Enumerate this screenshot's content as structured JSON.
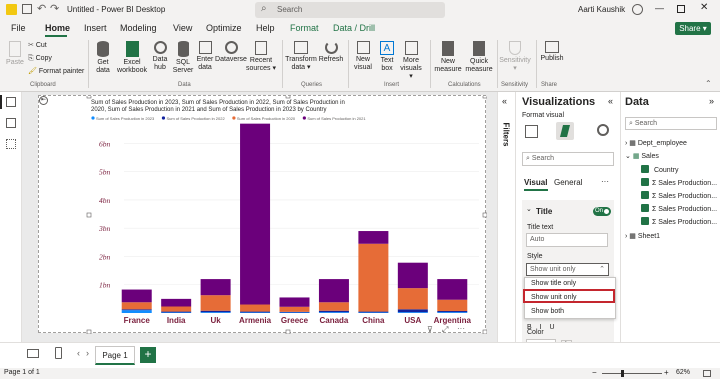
{
  "titlebar": {
    "title": "Untitled - Power BI Desktop",
    "search": "Search",
    "user": "Aarti Kaushik"
  },
  "tabs": [
    "File",
    "Home",
    "Insert",
    "Modeling",
    "View",
    "Optimize",
    "Help",
    "Format",
    "Data / Drill"
  ],
  "share_label": "Share",
  "ribbon": {
    "clipboard": {
      "paste": "Paste",
      "cut": "Cut",
      "copy": "Copy",
      "format_painter": "Format painter",
      "group": "Clipboard"
    },
    "data": {
      "get_data": "Get data",
      "excel": "Excel workbook",
      "hub": "Data hub",
      "sql": "SQL Server",
      "enter": "Enter data",
      "dataverse": "Dataverse",
      "recent": "Recent sources",
      "group": "Data"
    },
    "queries": {
      "transform": "Transform data",
      "refresh": "Refresh",
      "group": "Queries"
    },
    "insert": {
      "new_visual": "New visual",
      "text_box": "Text box",
      "more_visuals": "More visuals",
      "group": "Insert"
    },
    "calculations": {
      "new_measure": "New measure",
      "quick_measure": "Quick measure",
      "group": "Calculations"
    },
    "sensitivity": {
      "label": "Sensitivity",
      "group": "Sensitivity"
    },
    "share": {
      "publish": "Publish",
      "group": "Share"
    }
  },
  "chart_data": {
    "type": "bar",
    "title": "Sum of Sales Production in 2023, Sum of Sales Production in 2022, Sum of Sales Production in 2020, Sum of Sales Production in 2021 and Sum of Sales Production in 2023 by Country",
    "legend": [
      {
        "name": "Sum of Sales Production in 2023",
        "color": "#118DFF"
      },
      {
        "name": "Sum of Sales Production in 2022",
        "color": "#12239E"
      },
      {
        "name": "Sum of Sales Production in 2020",
        "color": "#E66C37"
      },
      {
        "name": "Sum of Sales Production in 2021",
        "color": "#6B007B"
      }
    ],
    "categories": [
      "France",
      "India",
      "Uk",
      "Armenia",
      "Greece",
      "Canada",
      "China",
      "USA",
      "Argentina"
    ],
    "series": [
      {
        "name": "Sum of Sales Production in 2023",
        "color": "#118DFF",
        "values": [
          0.1,
          0.02,
          0.03,
          0.02,
          0.02,
          0.03,
          0.02,
          0.03,
          0.03
        ]
      },
      {
        "name": "Sum of Sales Production in 2022",
        "color": "#12239E",
        "values": [
          0.03,
          0.03,
          0.05,
          0.03,
          0.02,
          0.05,
          0.03,
          0.1,
          0.04
        ]
      },
      {
        "name": "Sum of Sales Production in 2020",
        "color": "#E66C37",
        "values": [
          0.25,
          0.18,
          0.55,
          0.25,
          0.18,
          0.3,
          2.4,
          0.75,
          0.4
        ]
      },
      {
        "name": "Sum of Sales Production in 2021",
        "color": "#6B007B",
        "values": [
          0.45,
          0.27,
          0.57,
          6.4,
          0.33,
          0.82,
          0.45,
          0.9,
          0.73
        ]
      }
    ],
    "yticks": [
      "1bn",
      "2bn",
      "3bn",
      "4bn",
      "5bn",
      "6bn"
    ],
    "ylim": [
      0,
      6.9
    ]
  },
  "page_tabs": {
    "page1": "Page 1",
    "add": "+"
  },
  "status": {
    "page": "Page 1 of 1",
    "zoom": "62%"
  },
  "filters_label": "Filters",
  "viz_pane": {
    "title": "Visualizations",
    "format_visual": "Format visual",
    "search": "Search",
    "tab_visual": "Visual",
    "tab_general": "General",
    "more": "···",
    "section_title": "Title",
    "toggle": "On",
    "title_text_label": "Title text",
    "title_text_placeholder": "Auto",
    "style_label": "Style",
    "style_value": "Show unit only",
    "options": [
      "Show title only",
      "Show unit only",
      "Show both"
    ],
    "color_label": "Color",
    "fx": "fx"
  },
  "data_pane": {
    "title": "Data",
    "search": "Search",
    "tables": [
      {
        "name": "Dept_employee",
        "expanded": false,
        "fields": []
      },
      {
        "name": "Sales",
        "expanded": true,
        "fields": [
          {
            "name": "Country",
            "sigma": false
          },
          {
            "name": "Sales Production...",
            "sigma": true
          },
          {
            "name": "Sales Production...",
            "sigma": true
          },
          {
            "name": "Sales Production...",
            "sigma": true
          },
          {
            "name": "Sales Production...",
            "sigma": true
          }
        ]
      },
      {
        "name": "Sheet1",
        "expanded": false,
        "fields": []
      }
    ]
  },
  "colors": {
    "accent": "#217346",
    "highlight_border": "#C4262E",
    "axis_label": "#7A1F3D"
  }
}
